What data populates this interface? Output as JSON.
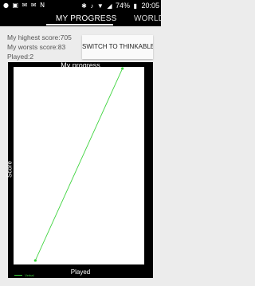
{
  "status_bar": {
    "icons_left": [
      "messenger-icon",
      "gallery-icon",
      "mail-icon",
      "mail-icon",
      "nfc-icon"
    ],
    "icons_right": [
      "bluetooth-icon",
      "mute-icon",
      "wifi-icon",
      "signal-icon",
      "battery-icon"
    ],
    "battery": "74%",
    "time": "20:05"
  },
  "tabs": [
    {
      "label": "MY PROGRESS",
      "active": true
    },
    {
      "label": "WORLD",
      "active": false
    }
  ],
  "info": {
    "highest": "My highest score:705",
    "worst": "My worsts score:83",
    "played": "Played:2"
  },
  "switch_button": "SWITCH TO THINKABLE",
  "chart_data": {
    "type": "line",
    "title": "My progress",
    "xlabel": "Played",
    "ylabel": "Score",
    "x": [
      1,
      2
    ],
    "series": [
      {
        "name": "Verbal",
        "values": [
          83,
          705
        ],
        "color": "#3fd43f"
      }
    ],
    "ylim": [
      70,
      710
    ],
    "xlim": [
      0.75,
      2.25
    ],
    "grid": false,
    "legend": "bottom-left",
    "colors": {
      "panel": "#000000",
      "plot": "#ffffff",
      "line": "#3fd43f"
    }
  }
}
